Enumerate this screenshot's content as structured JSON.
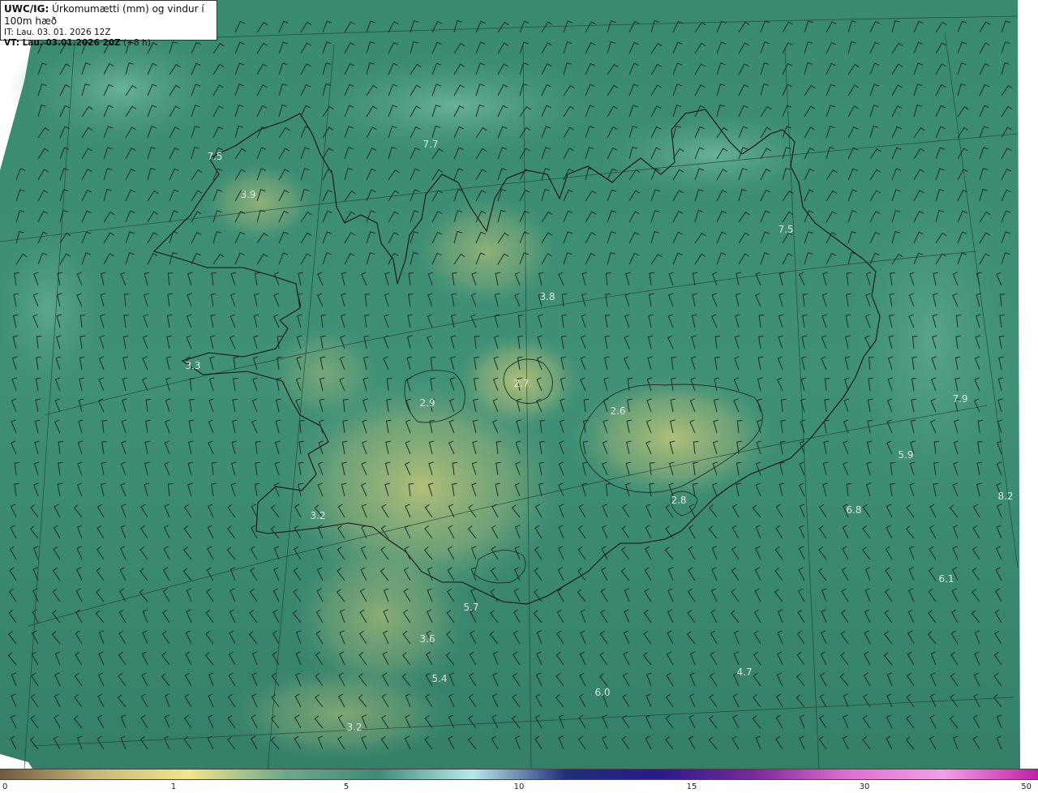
{
  "header": {
    "model": "UWC/IG:",
    "title": "Úrkomumætti (mm) og vindur í 100m hæð",
    "init_time": "IT: Lau. 03. 01. 2026 12Z",
    "valid_label": "VT: Lau. 03.01.2026 20Z",
    "valid_offset": "(+8 h)"
  },
  "colorbar": {
    "ticks": [
      "0",
      "1",
      "5",
      "10",
      "15",
      "30",
      "50"
    ],
    "colors": [
      "#6f5a3e",
      "#c7b77a",
      "#f1e68c",
      "#6fa98c",
      "#3f8a78",
      "#b7eaea",
      "#1f2f7a",
      "#2a1a8a",
      "#7a2a9a",
      "#e070d0",
      "#f0a0e8",
      "#c020a0"
    ]
  },
  "values": [
    {
      "text": "7.7",
      "name": "label-north-sea"
    },
    {
      "text": "7.5",
      "name": "label-westfjords-north"
    },
    {
      "text": "3.9",
      "name": "label-westfjords"
    },
    {
      "text": "7.5",
      "name": "label-northeast"
    },
    {
      "text": "3.8",
      "name": "label-north-central"
    },
    {
      "text": "3.3",
      "name": "label-snaefellsnes"
    },
    {
      "text": "2.7",
      "name": "label-hofsjokull"
    },
    {
      "text": "2.9",
      "name": "label-langjokull"
    },
    {
      "text": "2.8",
      "name": "label-vatnajokull"
    },
    {
      "text": "7.9",
      "name": "label-east-sea"
    },
    {
      "text": "5.9",
      "name": "label-east-coast"
    },
    {
      "text": "8.2",
      "name": "label-far-east"
    },
    {
      "text": "6.8",
      "name": "label-southeast-sea"
    },
    {
      "text": "2.6",
      "name": "label-oraefi"
    },
    {
      "text": "3.2",
      "name": "label-reykjanes"
    },
    {
      "text": "6.1",
      "name": "label-southeast-far"
    },
    {
      "text": "5.7",
      "name": "label-south-coast"
    },
    {
      "text": "3.6",
      "name": "label-south-sea"
    },
    {
      "text": "5.4",
      "name": "label-south-sea-2"
    },
    {
      "text": "4.7",
      "name": "label-south-east-sea"
    },
    {
      "text": "6.0",
      "name": "label-south-central-sea"
    },
    {
      "text": "3.2",
      "name": "label-south-far"
    }
  ]
}
